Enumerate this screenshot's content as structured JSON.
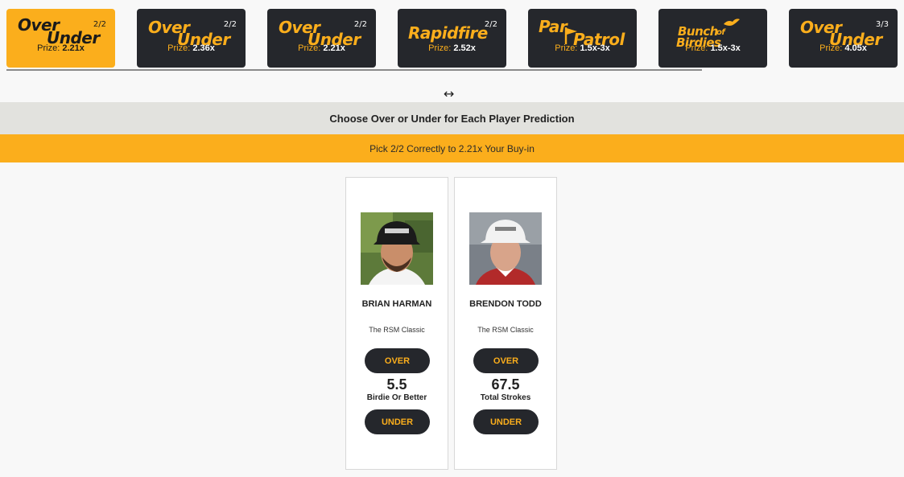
{
  "games": [
    {
      "logo_top": "Over",
      "logo_bottom": "Under",
      "count": "2/2",
      "prize_label": "Prize:",
      "prize_value": "2.21x",
      "active": true
    },
    {
      "logo_top": "Over",
      "logo_bottom": "Under",
      "count": "2/2",
      "prize_label": "Prize:",
      "prize_value": "2.36x",
      "active": false
    },
    {
      "logo_top": "Over",
      "logo_bottom": "Under",
      "count": "2/2",
      "prize_label": "Prize:",
      "prize_value": "2.21x",
      "active": false
    },
    {
      "logo_top": "Rapidfire",
      "logo_bottom": "",
      "count": "2/2",
      "prize_label": "Prize:",
      "prize_value": "2.52x",
      "active": false
    },
    {
      "logo_top": "Par",
      "logo_bottom": "Patrol",
      "count": "",
      "prize_label": "Prize:",
      "prize_value": "1.5x-3x",
      "active": false
    },
    {
      "logo_top": "Bunch",
      "logo_bottom": "Birdies",
      "logo_small": "of",
      "count": "",
      "prize_label": "Prize:",
      "prize_value": "1.5x-3x",
      "active": false
    },
    {
      "logo_top": "Over",
      "logo_bottom": "Under",
      "count": "3/3",
      "prize_label": "Prize:",
      "prize_value": "4.05x",
      "active": false
    }
  ],
  "resize_icon": "↔",
  "header": {
    "title": "Choose Over or Under for Each Player Prediction"
  },
  "banner": {
    "text": "Pick 2/2 Correctly to 2.21x Your Buy-in"
  },
  "players": [
    {
      "name": "BRIAN HARMAN",
      "event": "The RSM Classic",
      "over_label": "OVER",
      "under_label": "UNDER",
      "line": "5.5",
      "stat": "Birdie Or Better"
    },
    {
      "name": "BRENDON TODD",
      "event": "The RSM Classic",
      "over_label": "OVER",
      "under_label": "UNDER",
      "line": "67.5",
      "stat": "Total Strokes"
    }
  ],
  "colors": {
    "accent": "#fbae1c",
    "dark": "#25272c",
    "header_bg": "#e2e2de"
  }
}
